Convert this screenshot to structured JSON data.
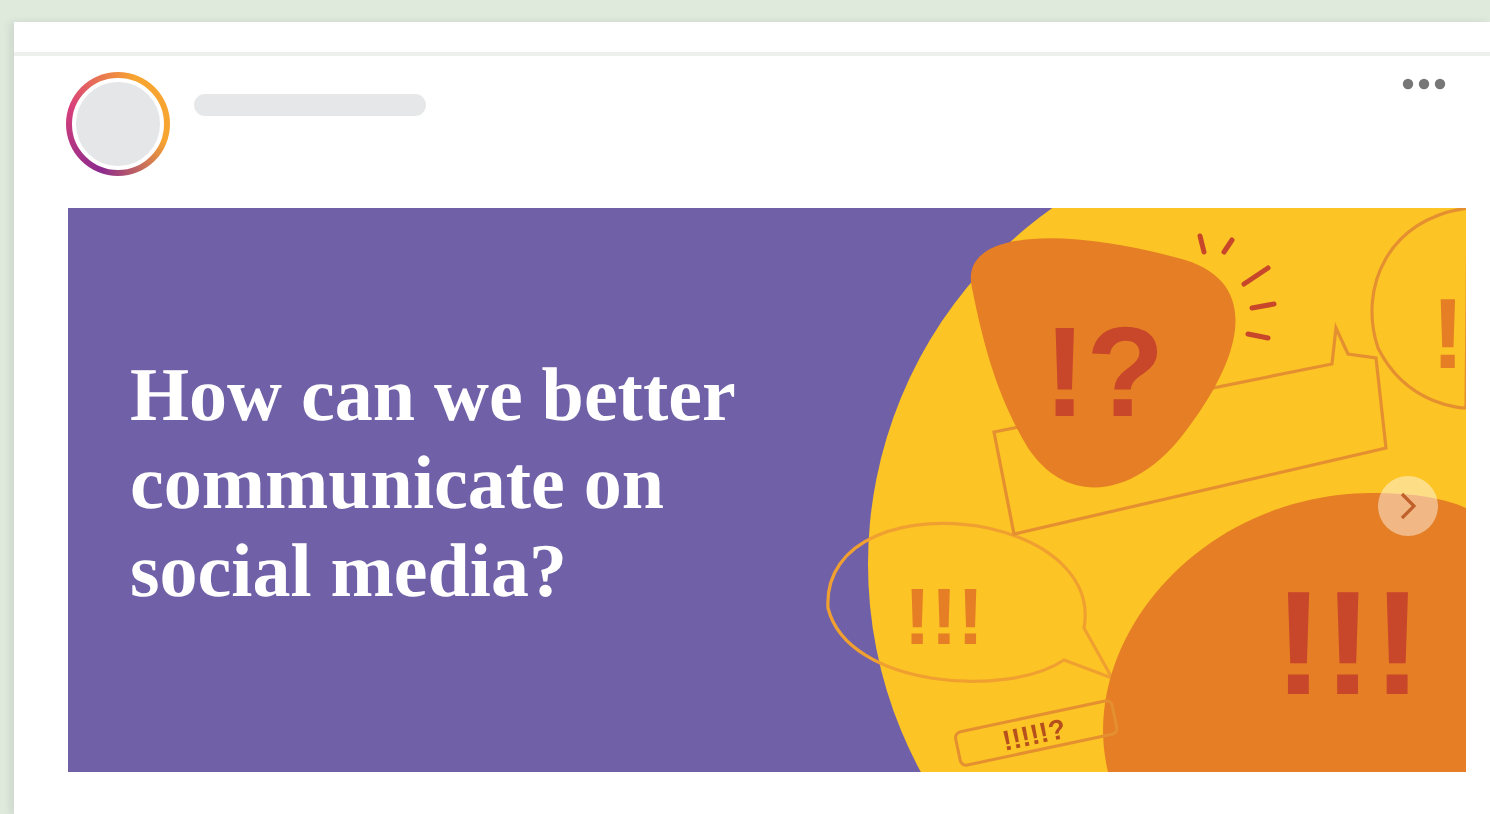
{
  "post": {
    "image": {
      "headline": "How can we better communicate on social media?",
      "artwork_marks": [
        {
          "kind": "big",
          "text": "!?"
        },
        {
          "kind": "small",
          "text": "!!!"
        },
        {
          "kind": "big",
          "text": "!!!"
        },
        {
          "kind": "side",
          "text": "!"
        },
        {
          "kind": "label",
          "text": "!!!!!?"
        }
      ]
    }
  }
}
